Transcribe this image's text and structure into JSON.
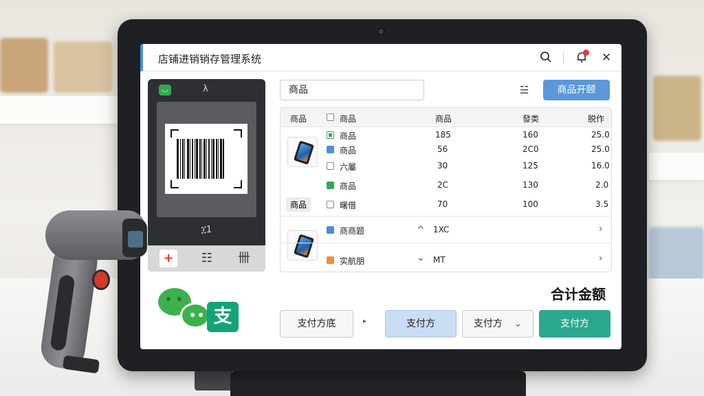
{
  "window": {
    "title": "店铺进销销存管理系统"
  },
  "titlebar": {
    "search_icon": "search-icon",
    "bell_icon": "bell-icon",
    "close_icon": "close-icon",
    "close_glyph": "✕"
  },
  "scanner_panel": {
    "top_glyph": "λ",
    "code_text": "፲1",
    "toolbar": {
      "add": "+",
      "list": "☷",
      "grid": "卌"
    }
  },
  "search": {
    "value": "商品"
  },
  "header_actions": {
    "filter_glyph": "☱",
    "primary_label": "商品开颐"
  },
  "table": {
    "headers": [
      "商品",
      "商品",
      "商品",
      "發类",
      "脱作"
    ],
    "rows": [
      {
        "name": "商品",
        "a": "185",
        "b": "160",
        "c": "25.0",
        "mark": "flag"
      },
      {
        "name": "商品",
        "a": "56",
        "b": "2C0",
        "c": "25.0",
        "mark": "blue"
      },
      {
        "name": "六屬",
        "a": "30",
        "b": "125",
        "c": "16.0",
        "mark": "empty"
      },
      {
        "name": "商品",
        "a": "2C",
        "b": "130",
        "c": "2.0",
        "mark": "green"
      },
      {
        "name": "曙借",
        "a": "70",
        "b": "100",
        "c": "3.5",
        "mark": "empty"
      }
    ],
    "row_tag": "商品",
    "sub_rows": [
      {
        "name": "商商题",
        "chev": "^",
        "value": "1XC",
        "arrow": "›",
        "color": "blue"
      },
      {
        "name": "实航朋",
        "chev": "⌄",
        "value": "MT",
        "arrow": "›",
        "color": "orange"
      }
    ]
  },
  "total": {
    "label": "合计金额"
  },
  "payment_buttons": [
    {
      "label": "支付方底",
      "style": "outline"
    },
    {
      "label": "支付方",
      "style": "lightblue"
    },
    {
      "label": "支付方",
      "style": "outline"
    },
    {
      "label": "支付方",
      "style": "teal"
    }
  ],
  "logos": {
    "alipay_char": "支"
  },
  "colors": {
    "accent": "#5b97d9",
    "teal": "#2aa88e",
    "wechat_green": "#3db24c",
    "alipay": "#11a37a",
    "alert_red": "#e53935"
  }
}
